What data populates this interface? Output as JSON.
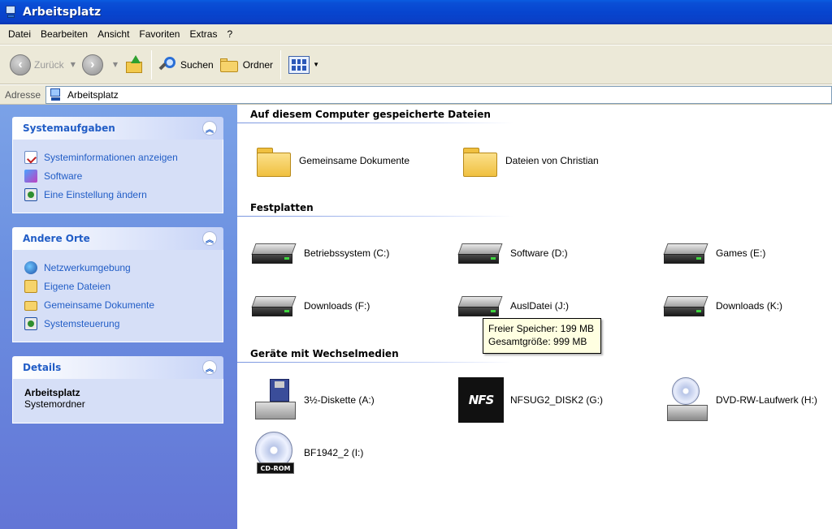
{
  "window": {
    "title": "Arbeitsplatz"
  },
  "menu": {
    "items": [
      "Datei",
      "Bearbeiten",
      "Ansicht",
      "Favoriten",
      "Extras",
      "?"
    ]
  },
  "toolbar": {
    "back_label": "Zurück",
    "search_label": "Suchen",
    "folders_label": "Ordner"
  },
  "address": {
    "label": "Adresse",
    "value": "Arbeitsplatz"
  },
  "sidebar": {
    "system_tasks": {
      "title": "Systemaufgaben",
      "items": [
        "Systeminformationen anzeigen",
        "Software",
        "Eine Einstellung ändern"
      ]
    },
    "other_places": {
      "title": "Andere Orte",
      "items": [
        "Netzwerkumgebung",
        "Eigene Dateien",
        "Gemeinsame Dokumente",
        "Systemsteuerung"
      ]
    },
    "details": {
      "title": "Details",
      "name": "Arbeitsplatz",
      "type": "Systemordner"
    }
  },
  "sections": {
    "stored_files": {
      "title": "Auf diesem Computer gespeicherte Dateien",
      "items": [
        "Gemeinsame Dokumente",
        "Dateien von Christian"
      ]
    },
    "hard_drives": {
      "title": "Festplatten",
      "items": [
        "Betriebssystem (C:)",
        "Software (D:)",
        "Games (E:)",
        "Downloads (F:)",
        "AuslDatei (J:)",
        "Downloads (K:)"
      ]
    },
    "removable": {
      "title": "Geräte mit Wechselmedien",
      "items": [
        "3½-Diskette (A:)",
        "NFSUG2_DISK2 (G:)",
        "DVD-RW-Laufwerk (H:)",
        "BF1942_2 (I:)"
      ]
    }
  },
  "icons": {
    "nfs_label": "NFS",
    "cdrom_badge": "CD-ROM"
  },
  "tooltip": {
    "free": "Freier Speicher: 199 MB",
    "total": "Gesamtgröße: 999 MB"
  },
  "colors": {
    "title_blue": "#0a4fd6",
    "task_pane": "#6b8fe0",
    "link_blue": "#215dc6"
  }
}
